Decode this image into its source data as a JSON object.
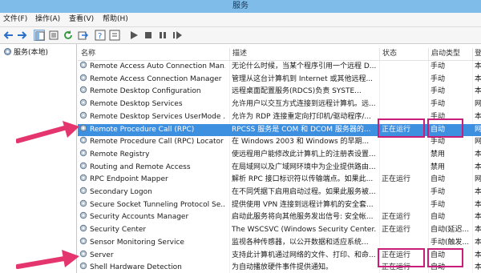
{
  "window": {
    "title": "服务"
  },
  "menu": [
    "文件(F)",
    "操作(A)",
    "查看(V)",
    "帮助(H)"
  ],
  "toolbar": {
    "icons": [
      "back-arrow-icon",
      "forward-arrow-icon",
      "console-tree-icon",
      "list-view-icon",
      "refresh-icon",
      "export-icon",
      "help-icon",
      "properties-icon",
      "play-icon",
      "stop-icon",
      "pause-icon",
      "restart-icon"
    ]
  },
  "sidebar": {
    "root_label": "服务(本地)"
  },
  "table": {
    "headers": {
      "name": "名称",
      "desc": "描述",
      "status": "状态",
      "startup": "启动类型",
      "logon": "登"
    },
    "rows": [
      {
        "name": "Remote Access Auto Connection Man...",
        "desc": "无论什么时候，当某个程序引用一个远程 D...",
        "status": "",
        "startup": "手动",
        "logon": "本"
      },
      {
        "name": "Remote Access Connection Manager",
        "desc": "管理从这台计算机到 Internet 或其他远程...",
        "status": "",
        "startup": "手动",
        "logon": "本"
      },
      {
        "name": "Remote Desktop Configuration",
        "desc": "远程桌面配置服务(RDCS)负责 SYSTE...",
        "status": "",
        "startup": "手动",
        "logon": "本"
      },
      {
        "name": "Remote Desktop Services",
        "desc": "允许用户以交互方式连接到远程计算机。远...",
        "status": "",
        "startup": "手动",
        "logon": "网"
      },
      {
        "name": "Remote Desktop Services UserMode ...",
        "desc": "允许为 RDP 连接重定向打印机/驱动程序/...",
        "status": "",
        "startup": "手动",
        "logon": "本"
      },
      {
        "name": "Remote Procedure Call (RPC)",
        "desc": "RPCSS 服务是 COM 和 DCOM 服务器的...",
        "status": "正在运行",
        "startup": "自动",
        "logon": "网"
      },
      {
        "name": "Remote Procedure Call (RPC) Locator",
        "desc": "在 Windows 2003 和 Windows 的早期...",
        "status": "",
        "startup": "手动",
        "logon": "网"
      },
      {
        "name": "Remote Registry",
        "desc": "使远程用户能修改此计算机上的注册表设置...",
        "status": "",
        "startup": "禁用",
        "logon": "本"
      },
      {
        "name": "Routing and Remote Access",
        "desc": "在局域网以及广域网环境中为企业提供路由...",
        "status": "",
        "startup": "禁用",
        "logon": "本"
      },
      {
        "name": "RPC Endpoint Mapper",
        "desc": "解析 RPC 接口标识符以传输端点。如果此...",
        "status": "正在运行",
        "startup": "自动",
        "logon": "网"
      },
      {
        "name": "Secondary Logon",
        "desc": "在不同凭据下启用启动过程。如果此服务被...",
        "status": "",
        "startup": "手动",
        "logon": "本"
      },
      {
        "name": "Secure Socket Tunneling Protocol Se...",
        "desc": "提供使用 VPN 连接到远程计算机的安全套...",
        "status": "",
        "startup": "手动",
        "logon": "本"
      },
      {
        "name": "Security Accounts Manager",
        "desc": "启动此服务将向其他服务发出信号: 安全帐...",
        "status": "正在运行",
        "startup": "自动",
        "logon": "本"
      },
      {
        "name": "Security Center",
        "desc": "The WSCSVC (Windows Security Center...",
        "status": "正在运行",
        "startup": "自动(延迟...",
        "logon": "本"
      },
      {
        "name": "Sensor Monitoring Service",
        "desc": "监视各种传感器，以公开数据和适应系统...",
        "status": "",
        "startup": "手动(触发...",
        "logon": "本"
      },
      {
        "name": "Server",
        "desc": "支持此计算机通过网络的文件、打印、和命...",
        "status": "正在运行",
        "startup": "自动",
        "logon": "本"
      },
      {
        "name": "Shell Hardware Detection",
        "desc": "为自动播放硬件事件提供通知。",
        "status": "正在运行",
        "startup": "自动",
        "logon": "本"
      }
    ],
    "selected_row": 5
  },
  "colors": {
    "selection": "#3d8fe0",
    "annotation": "#c81e7a",
    "titlebar": "#7fbcea"
  }
}
